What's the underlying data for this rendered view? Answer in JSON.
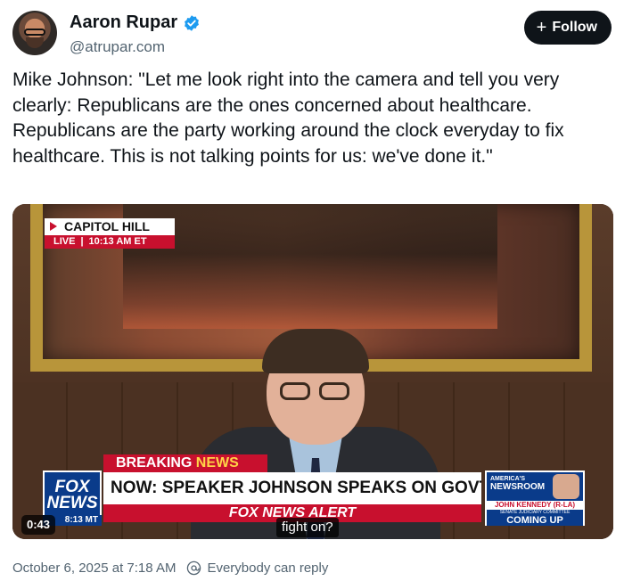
{
  "author": {
    "display_name": "Aaron Rupar",
    "handle": "@atrupar.com",
    "avatar_icon": "avatar",
    "verified_icon": "verified-badge-icon",
    "verified_color": "#1d9bf0"
  },
  "actions": {
    "follow_label": "Follow",
    "follow_icon": "plus-icon"
  },
  "post": {
    "text": "Mike Johnson: \"Let me look right into the camera and tell you very clearly: Republicans are the ones concerned about healthcare. Republicans are the party working around the clock everyday to fix healthcare. This is not talking points for us: we've done it.\""
  },
  "video": {
    "duration": "0:43",
    "caption": "fight on?",
    "location_bug": "CAPITOL HILL",
    "live_label": "LIVE",
    "live_time": "10:13 AM ET",
    "breaking_label_a": "BREAKING ",
    "breaking_label_b": "NEWS",
    "headline": "NOW: SPEAKER JOHNSON SPEAKS ON GOVT SHUTDOWN",
    "alert": "FOX NEWS ALERT",
    "network_logo_line1": "FOX",
    "network_logo_line2": "NEWS",
    "clock_strip": "8:13 MT",
    "promo_show_line1": "AMERICA'S",
    "promo_show_line2": "NEWSROOM",
    "promo_guest": "JOHN KENNEDY (R-LA)",
    "promo_role": "SENATE JUDICIARY COMMITTEE",
    "promo_coming": "COMING UP",
    "brand_red": "#c8102e",
    "brand_blue": "#0a3b8a"
  },
  "footer": {
    "timestamp": "October 6, 2025 at 7:18 AM",
    "reply_setting": "Everybody can reply",
    "reply_icon": "at-sign-icon"
  }
}
